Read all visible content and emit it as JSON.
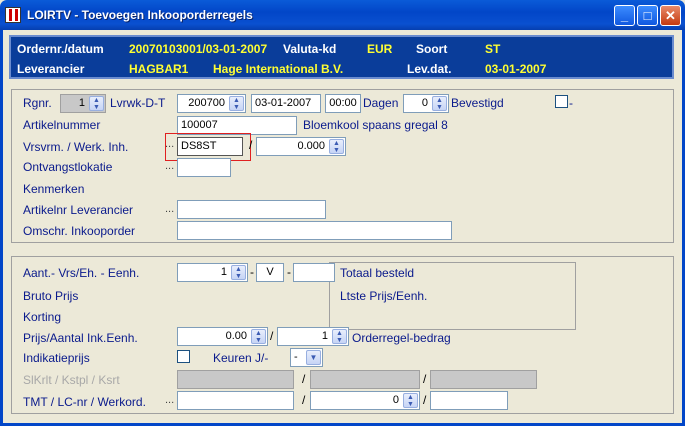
{
  "window": {
    "title": "LOIRTV - Toevoegen Inkooporderregels",
    "minimize": "_",
    "maximize": "□",
    "close": "✕"
  },
  "header": {
    "order_label": "Ordernr./datum",
    "order_value": "20070103001/03-01-2007",
    "currency_label": "Valuta-kd",
    "currency_value": "EUR",
    "type_label": "Soort",
    "type_value": "ST",
    "supplier_label": "Leverancier",
    "supplier_code": "HAGBAR1",
    "supplier_name": "Hage International B.V.",
    "delivery_label": "Lev.dat.",
    "delivery_value": "03-01-2007"
  },
  "top": {
    "rgnr_label": "Rgnr.",
    "rgnr_value": "1",
    "lvrwk_label": "Lvrwk-D-T",
    "week_value": "200700",
    "date_value": "03-01-2007",
    "time_value": "00:00",
    "days_label": "Dagen",
    "days_value": "0",
    "confirmed_label": "Bevestigd",
    "confirmed_suffix": "-",
    "article_label": "Artikelnummer",
    "article_value": "100007",
    "article_desc": "Bloemkool spaans gregal 8",
    "unit_label": "Vrsvrm. / Werk. Inh.",
    "unit_value": "DS8ST",
    "unit_slash": "/",
    "content_value": "0.000",
    "location_label": "Ontvangstlokatie",
    "location_value": "",
    "marks_label": "Kenmerken",
    "supplier_article_label": "Artikelnr Leverancier",
    "supplier_article_value": "",
    "description_label": "Omschr. Inkooporder",
    "description_value": ""
  },
  "bottom": {
    "qty_label": "Aant.- Vrs/Eh. - Eenh.",
    "qty_value": "1",
    "unit_type": "V",
    "dash": "-",
    "unit_extra": "",
    "total_label": "Totaal besteld",
    "gross_label": "Bruto Prijs",
    "last_price_label": "Ltste Prijs/Eenh.",
    "discount_label": "Korting",
    "price_label": "Prijs/Aantal Ink.Eenh.",
    "price_value": "0.00",
    "slash": "/",
    "per_value": "1",
    "line_amount_label": "Orderregel-bedrag",
    "indicative_label": "Indikatieprijs",
    "inspect_label": "Keuren J/-",
    "inspect_value": "-",
    "cost_label": "SlKrlt / Kstpl / Ksrt",
    "tmt_label": "TMT / LC-nr / Werkord.",
    "tmt_value": "0"
  },
  "icons": {
    "dots": "...",
    "spin": "▲▼",
    "dropdown": "▼"
  }
}
